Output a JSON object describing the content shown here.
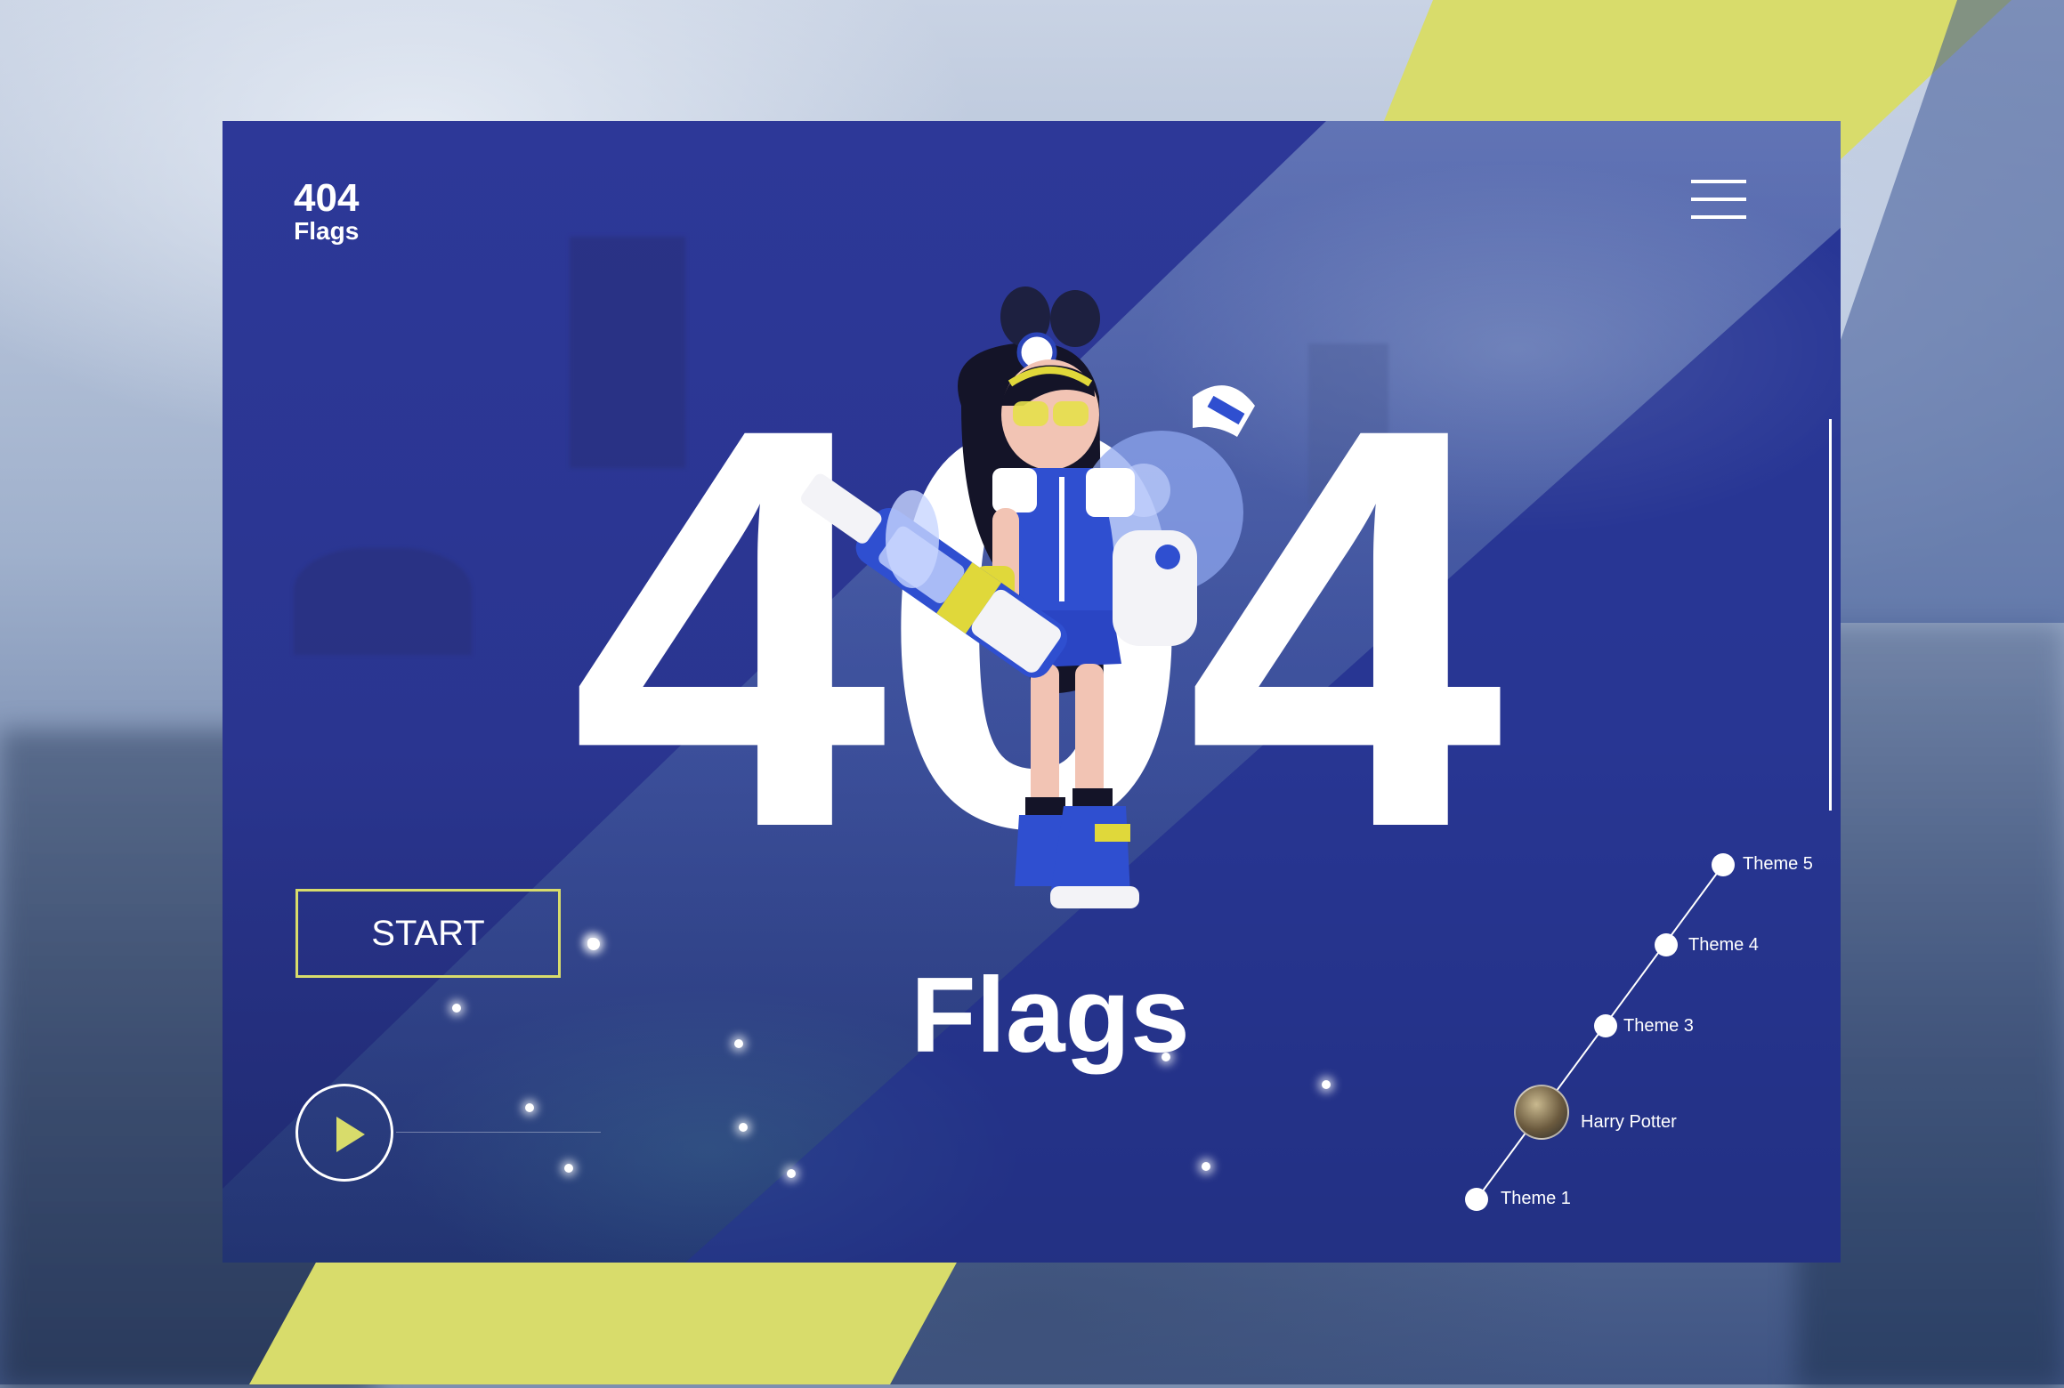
{
  "logo": {
    "title": "404",
    "subtitle": "Flags"
  },
  "hero": {
    "number": "404",
    "word": "Flags"
  },
  "start_button": {
    "label": "START"
  },
  "menu": {
    "icon": "hamburger-icon"
  },
  "play": {
    "icon": "play-icon"
  },
  "colors": {
    "accent": "#d8dc6b",
    "card": "#2c3a9b",
    "text": "#ffffff"
  },
  "themes": [
    {
      "label": "Theme 5",
      "type": "dot"
    },
    {
      "label": "Theme 4",
      "type": "dot"
    },
    {
      "label": "Theme 3",
      "type": "dot"
    },
    {
      "label": "Harry Potter",
      "type": "avatar"
    },
    {
      "label": "Theme 1",
      "type": "dot"
    }
  ]
}
